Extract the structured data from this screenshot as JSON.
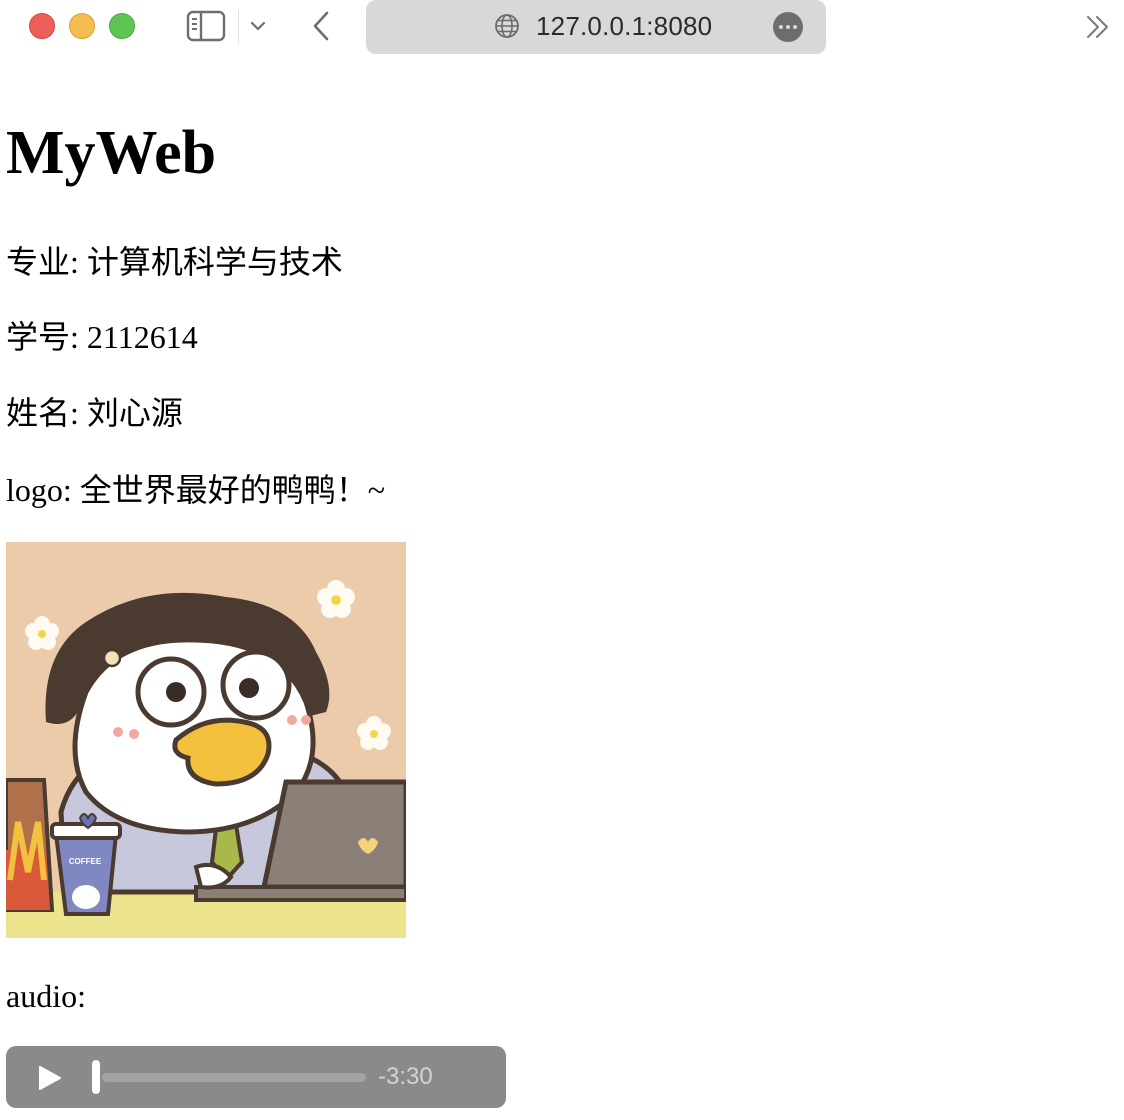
{
  "browser": {
    "url": "127.0.0.1:8080",
    "icons": {
      "sidebar": "sidebar-icon",
      "tab_overview_chevron": "chevron-down-icon",
      "back": "chevron-left-icon",
      "site": "globe-icon",
      "page_menu": "more-icon",
      "tabs": "double-chevron-right-icon"
    },
    "traffic_lights": {
      "close": "#ee5f57",
      "minimize": "#f4bd4f",
      "zoom": "#5fc454"
    }
  },
  "page": {
    "title": "MyWeb",
    "major": "专业: 计算机科学与技术",
    "student_id": "学号: 2112614",
    "name": "姓名: 刘心源",
    "logo_label": "logo: 全世界最好的鸭鸭！~",
    "logo_image": {
      "cup_text": "COFFEE"
    },
    "audio_label": "audio:"
  },
  "audio_player": {
    "time_remaining": "-3:30",
    "progress": 0,
    "icons": {
      "play": "play-icon"
    }
  }
}
